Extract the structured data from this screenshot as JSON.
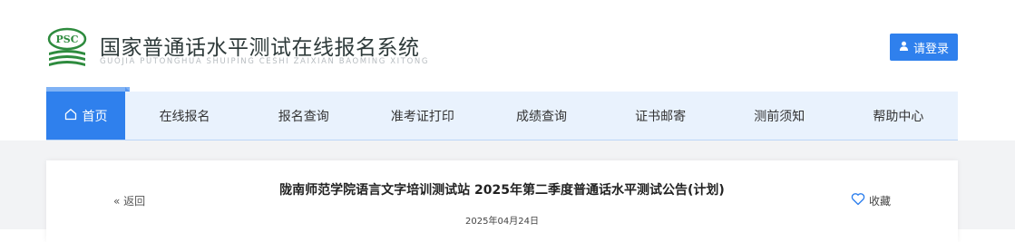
{
  "header": {
    "logo_text": "PSC",
    "title_cn": "国家普通话水平测试在线报名系统",
    "title_en": "GUOJIA PUTONGHUA SHUIPING CESHI ZAIXIAN BAOMING XITONG",
    "login_label": "请登录"
  },
  "nav": {
    "home_label": "首页",
    "items": [
      {
        "label": "在线报名"
      },
      {
        "label": "报名查询"
      },
      {
        "label": "准考证打印"
      },
      {
        "label": "成绩查询"
      },
      {
        "label": "证书邮寄"
      },
      {
        "label": "测前须知"
      },
      {
        "label": "帮助中心"
      }
    ]
  },
  "article": {
    "back_label": "« 返回",
    "title": "陇南师范学院语言文字培训测试站 2025年第二季度普通话水平测试公告(计划)",
    "date": "2025年04月24日",
    "favorite_label": "收藏"
  },
  "colors": {
    "accent": "#2f80ed",
    "nav_bg": "#e9f2fd",
    "logo_green": "#2e8b3e",
    "page_bg": "#f2f3f5"
  },
  "icons": {
    "login": "user-icon",
    "home": "home-icon",
    "favorite": "heart-icon"
  }
}
